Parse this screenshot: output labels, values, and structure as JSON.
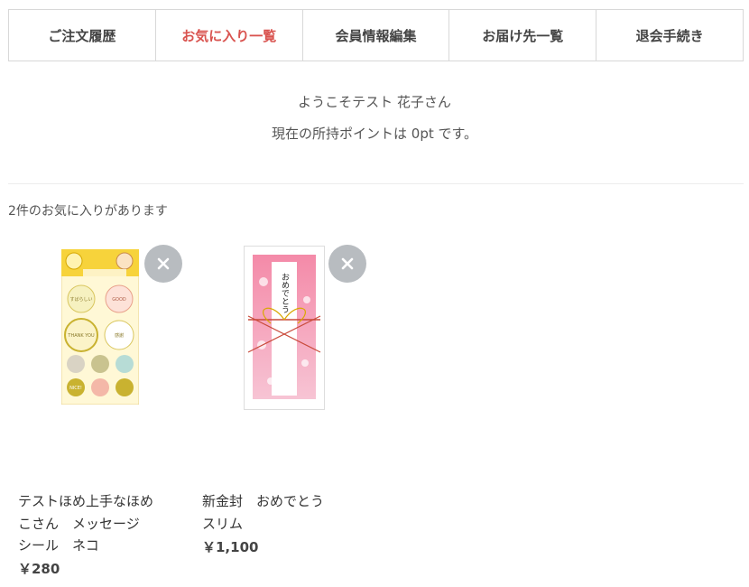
{
  "tabs": [
    {
      "label": "ご注文履歴"
    },
    {
      "label": "お気に入り一覧"
    },
    {
      "label": "会員情報編集"
    },
    {
      "label": "お届け先一覧"
    },
    {
      "label": "退会手続き"
    }
  ],
  "welcome": {
    "greeting": "ようこそテスト 花子さん",
    "points": "現在の所持ポイントは 0pt です。"
  },
  "favorites": {
    "count_text": "2件のお気に入りがあります",
    "items": [
      {
        "name": "テストほめ上手なほめ\nこさん　メッセージ\nシール　ネコ",
        "price": "￥280",
        "thumb_text": [
          "すばらしい",
          "GOOD",
          "THANK YOU",
          "感謝",
          "NICE!"
        ]
      },
      {
        "name": "新金封　おめでとう\nスリム",
        "price": "￥1,100",
        "thumb_text": "おめでとう"
      }
    ]
  },
  "icons": {
    "remove": "close-icon"
  },
  "colors": {
    "active_tab": "#d9534f",
    "remove_button": "#b8bcc0"
  }
}
